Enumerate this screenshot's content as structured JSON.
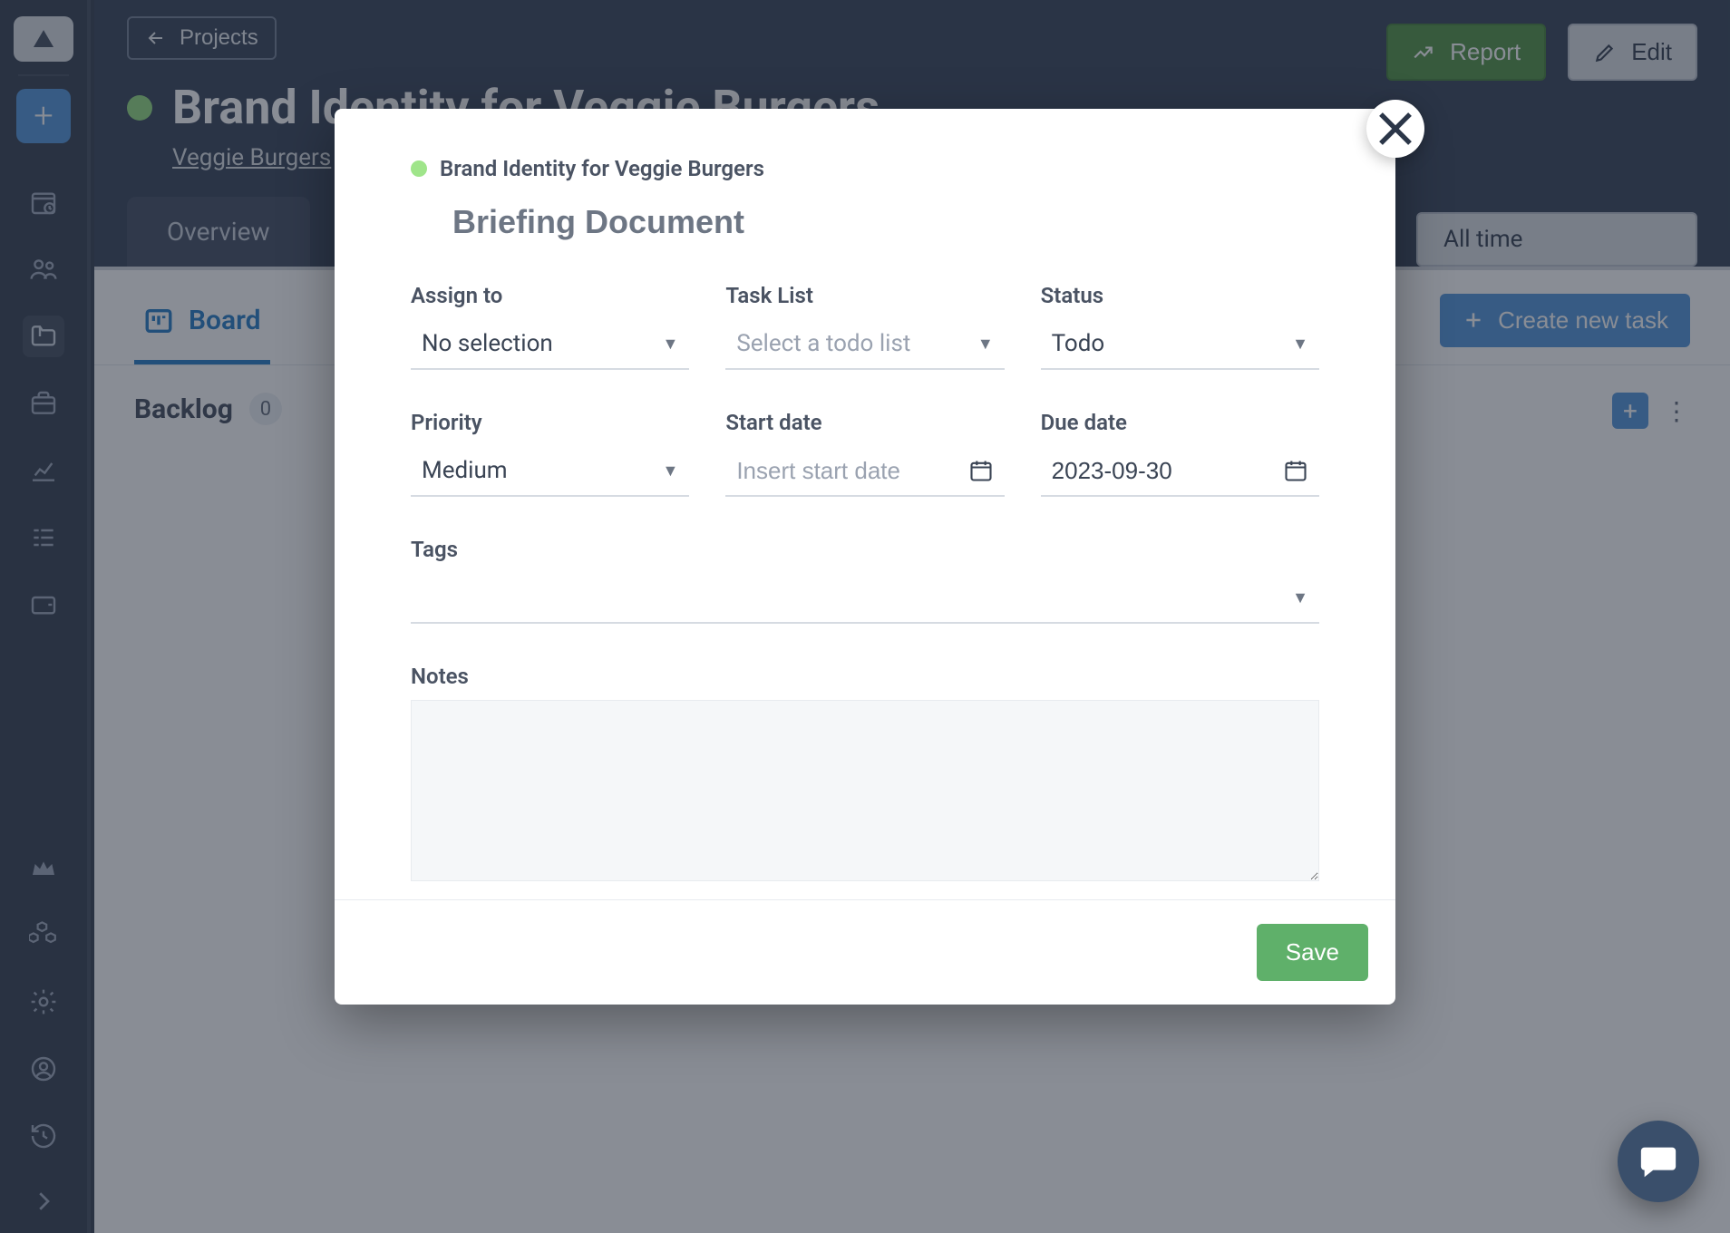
{
  "sidebar": {
    "logo_glyph": "⛰",
    "add_label": "+"
  },
  "header": {
    "back_label": "Projects",
    "report_label": "Report",
    "edit_label": "Edit",
    "project_title": "Brand Identity for Veggie Burgers",
    "client_name": "Veggie Burgers",
    "time_filter": "All time"
  },
  "tabs": {
    "overview": "Overview"
  },
  "subtabs": {
    "board": "Board",
    "create_task": "Create new task"
  },
  "board": {
    "columns": [
      {
        "title": "Backlog",
        "count": "0"
      }
    ]
  },
  "modal": {
    "project": "Brand Identity for Veggie Burgers",
    "task_name": "Briefing Document",
    "fields": {
      "assign_label": "Assign to",
      "assign_value": "No selection",
      "tasklist_label": "Task List",
      "tasklist_value": "Select a todo list",
      "status_label": "Status",
      "status_value": "Todo",
      "priority_label": "Priority",
      "priority_value": "Medium",
      "start_label": "Start date",
      "start_placeholder": "Insert start date",
      "start_value": "",
      "due_label": "Due date",
      "due_value": "2023-09-30",
      "tags_label": "Tags",
      "notes_label": "Notes"
    },
    "save_label": "Save"
  }
}
